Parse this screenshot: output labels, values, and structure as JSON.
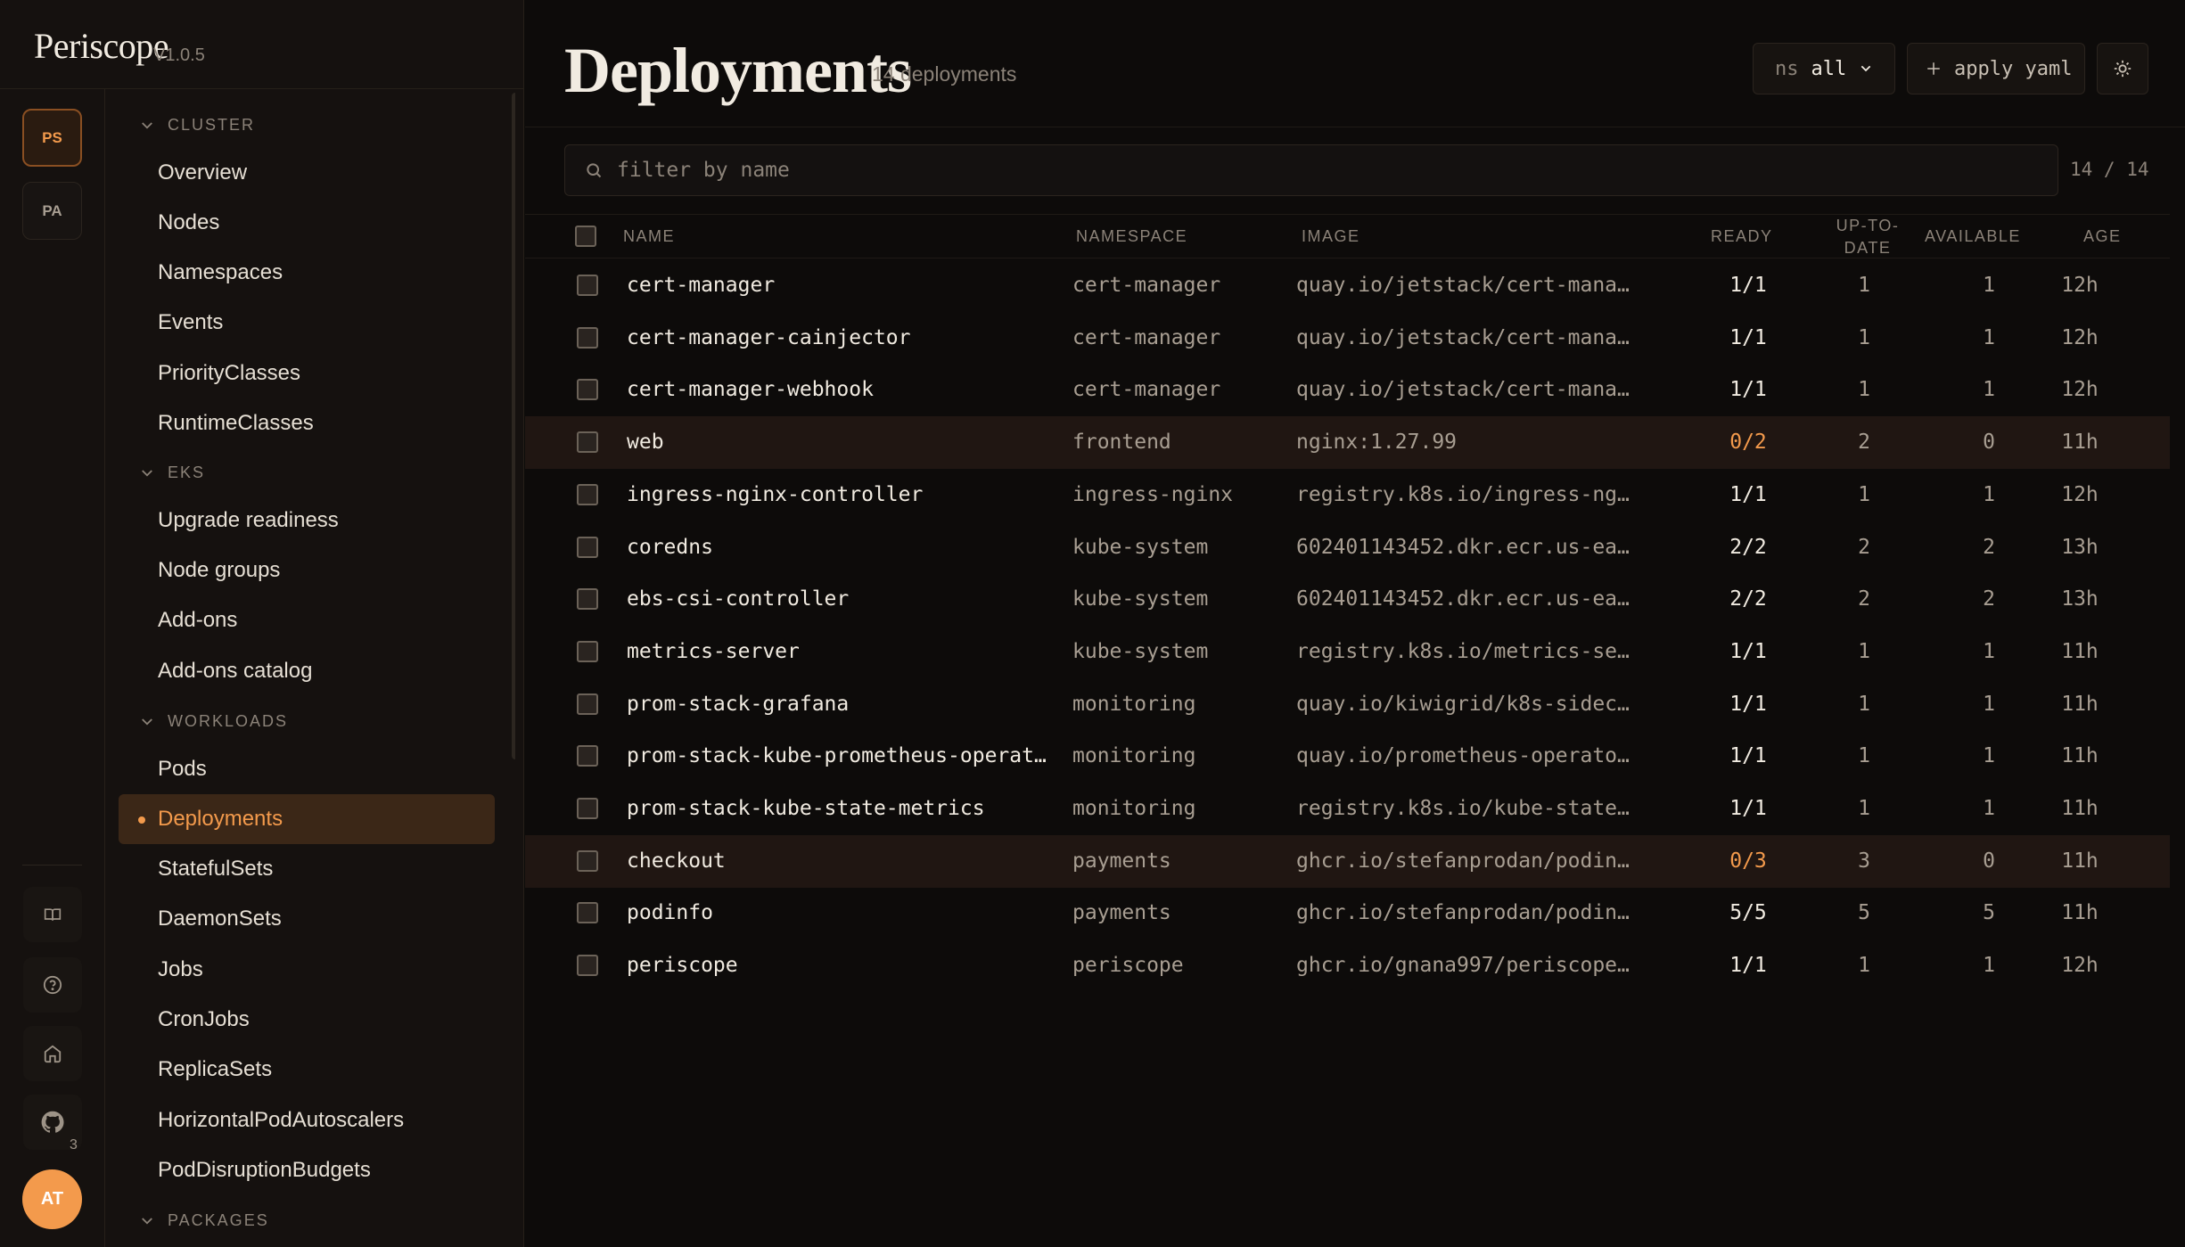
{
  "brand": {
    "name": "Periscope",
    "version": "V1.0.5"
  },
  "clusters": [
    "PS",
    "PA"
  ],
  "rail": {
    "github_badge": "3",
    "avatar": "AT"
  },
  "nav": {
    "cluster_label": "CLUSTER",
    "cluster_items": [
      "Overview",
      "Nodes",
      "Namespaces",
      "Events",
      "PriorityClasses",
      "RuntimeClasses"
    ],
    "eks_label": "EKS",
    "eks_items": [
      "Upgrade readiness",
      "Node groups",
      "Add-ons",
      "Add-ons catalog"
    ],
    "workloads_label": "WORKLOADS",
    "workloads_items": [
      "Pods",
      "Deployments",
      "StatefulSets",
      "DaemonSets",
      "Jobs",
      "CronJobs",
      "ReplicaSets",
      "HorizontalPodAutoscalers",
      "PodDisruptionBudgets"
    ],
    "packages_label": "PACKAGES",
    "active": "Deployments"
  },
  "header": {
    "title": "Deployments",
    "count": "14 deployments",
    "ns_prefix": "ns",
    "ns_value": "all",
    "apply_label": "apply yaml"
  },
  "search": {
    "placeholder": "filter by name",
    "value": "",
    "count": "14 / 14"
  },
  "table": {
    "columns": {
      "name": "NAME",
      "namespace": "NAMESPACE",
      "image": "IMAGE",
      "ready": "READY",
      "uptodate_1": "UP-TO-",
      "uptodate_2": "DATE",
      "available": "AVAILABLE",
      "age": "AGE"
    },
    "rows": [
      {
        "name": "cert-manager",
        "namespace": "cert-manager",
        "image": "quay.io/jetstack/cert-mana…",
        "ready": "1/1",
        "uptodate": "1",
        "available": "1",
        "age": "12h"
      },
      {
        "name": "cert-manager-cainjector",
        "namespace": "cert-manager",
        "image": "quay.io/jetstack/cert-mana…",
        "ready": "1/1",
        "uptodate": "1",
        "available": "1",
        "age": "12h"
      },
      {
        "name": "cert-manager-webhook",
        "namespace": "cert-manager",
        "image": "quay.io/jetstack/cert-mana…",
        "ready": "1/1",
        "uptodate": "1",
        "available": "1",
        "age": "12h"
      },
      {
        "name": "web",
        "namespace": "frontend",
        "image": "nginx:1.27.99",
        "ready": "0/2",
        "uptodate": "2",
        "available": "0",
        "age": "11h"
      },
      {
        "name": "ingress-nginx-controller",
        "namespace": "ingress-nginx",
        "image": "registry.k8s.io/ingress-ng…",
        "ready": "1/1",
        "uptodate": "1",
        "available": "1",
        "age": "12h"
      },
      {
        "name": "coredns",
        "namespace": "kube-system",
        "image": "602401143452.dkr.ecr.us-ea…",
        "ready": "2/2",
        "uptodate": "2",
        "available": "2",
        "age": "13h"
      },
      {
        "name": "ebs-csi-controller",
        "namespace": "kube-system",
        "image": "602401143452.dkr.ecr.us-ea…",
        "ready": "2/2",
        "uptodate": "2",
        "available": "2",
        "age": "13h"
      },
      {
        "name": "metrics-server",
        "namespace": "kube-system",
        "image": "registry.k8s.io/metrics-se…",
        "ready": "1/1",
        "uptodate": "1",
        "available": "1",
        "age": "11h"
      },
      {
        "name": "prom-stack-grafana",
        "namespace": "monitoring",
        "image": "quay.io/kiwigrid/k8s-sidec…",
        "ready": "1/1",
        "uptodate": "1",
        "available": "1",
        "age": "11h"
      },
      {
        "name": "prom-stack-kube-prometheus-operat…",
        "namespace": "monitoring",
        "image": "quay.io/prometheus-operato…",
        "ready": "1/1",
        "uptodate": "1",
        "available": "1",
        "age": "11h"
      },
      {
        "name": "prom-stack-kube-state-metrics",
        "namespace": "monitoring",
        "image": "registry.k8s.io/kube-state…",
        "ready": "1/1",
        "uptodate": "1",
        "available": "1",
        "age": "11h"
      },
      {
        "name": "checkout",
        "namespace": "payments",
        "image": "ghcr.io/stefanprodan/podin…",
        "ready": "0/3",
        "uptodate": "3",
        "available": "0",
        "age": "11h"
      },
      {
        "name": "podinfo",
        "namespace": "payments",
        "image": "ghcr.io/stefanprodan/podin…",
        "ready": "5/5",
        "uptodate": "5",
        "available": "5",
        "age": "11h"
      },
      {
        "name": "periscope",
        "namespace": "periscope",
        "image": "ghcr.io/gnana997/periscope…",
        "ready": "1/1",
        "uptodate": "1",
        "available": "1",
        "age": "12h"
      }
    ]
  },
  "colors": {
    "accent": "#f39a4c",
    "background": "#0d0b0a",
    "sidebar": "#15110f",
    "active_bg": "#3b2717",
    "warn_row": "#201612"
  },
  "icons": [
    "chevron-down-icon",
    "book-icon",
    "help-icon",
    "home-icon",
    "github-icon",
    "plus-icon",
    "sun-icon",
    "search-icon"
  ]
}
